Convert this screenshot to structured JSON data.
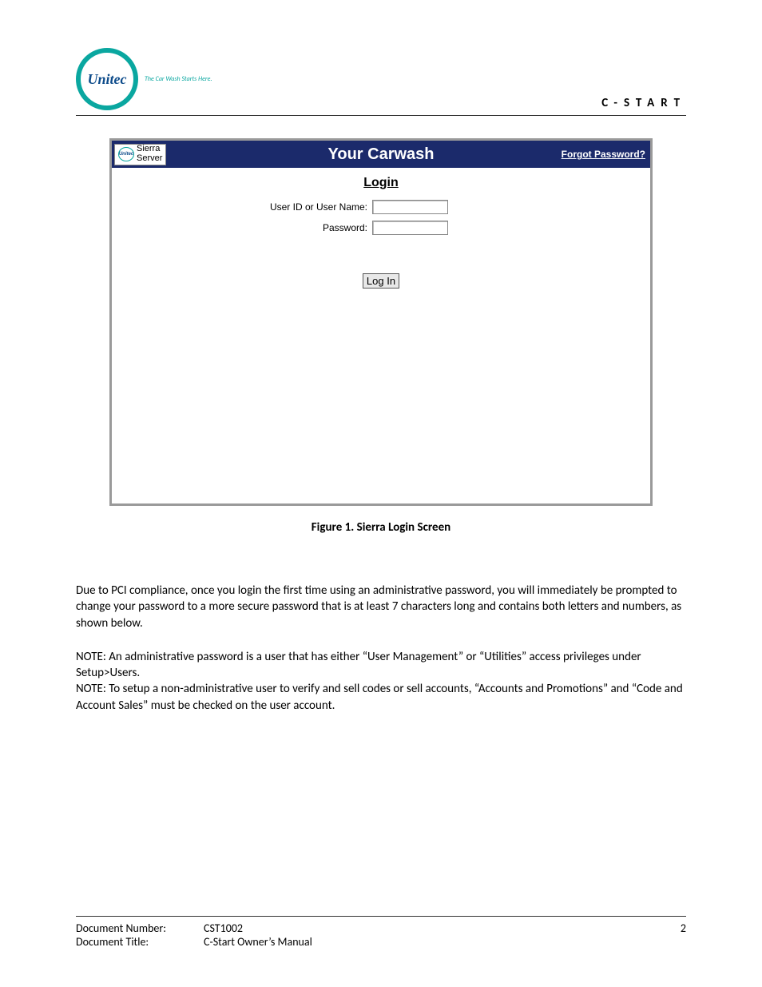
{
  "header": {
    "logo_text": "Unitec",
    "logo_tagline": "The Car Wash Starts Here.",
    "section_title": "C-START"
  },
  "app": {
    "badge": {
      "line1": "Sierra",
      "line2": "Server",
      "mini": "Unitec"
    },
    "title": "Your Carwash",
    "forgot_link": "Forgot Password?",
    "login": {
      "heading": "Login",
      "user_label": "User ID or User Name:",
      "password_label": "Password:",
      "button": "Log In"
    }
  },
  "figure_caption": "Figure 1. Sierra Login Screen",
  "paragraphs": {
    "p1": "Due to PCI compliance, once you login the first time using an administrative password, you will immediately be prompted to change your password to a more secure password that is at least 7 characters long and contains both letters and numbers, as shown below.",
    "p2": "NOTE: An administrative password is a user that has either “User Management” or “Utilities” access privileges under Setup>Users.",
    "p3": "NOTE: To setup a non-administrative user to verify and sell codes or sell accounts, “Accounts and Promotions” and “Code and Account Sales” must be checked on the user account."
  },
  "footer": {
    "doc_number_label": "Document Number:",
    "doc_number_value": "CST1002",
    "doc_title_label": "Document Title:",
    "doc_title_value": "C-Start Owner’s Manual",
    "page_number": "2"
  }
}
